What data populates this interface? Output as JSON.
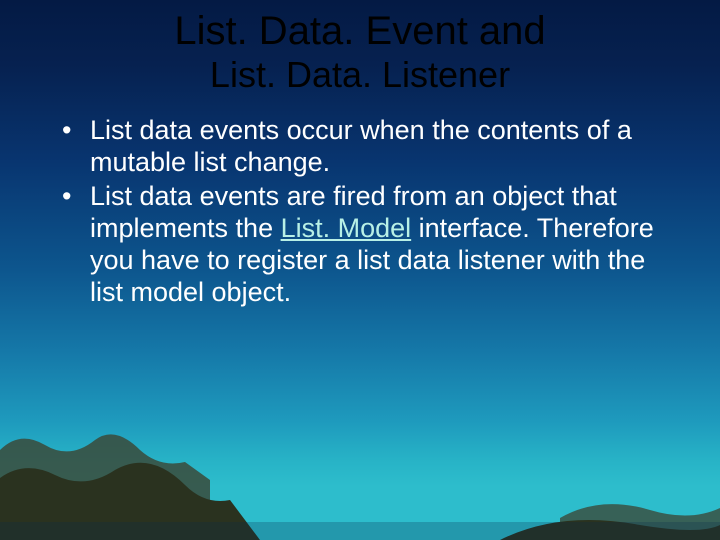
{
  "title": {
    "line1": "List. Data. Event and",
    "line2": "List. Data. Listener"
  },
  "bullets": [
    {
      "pre": "List data events occur when the contents of a mutable list change.",
      "link": null,
      "post": null
    },
    {
      "pre": "List data events are fired from an object that implements the ",
      "link": "List. Model",
      "post": " interface. Therefore you have to register a list data listener with the list model object."
    }
  ]
}
